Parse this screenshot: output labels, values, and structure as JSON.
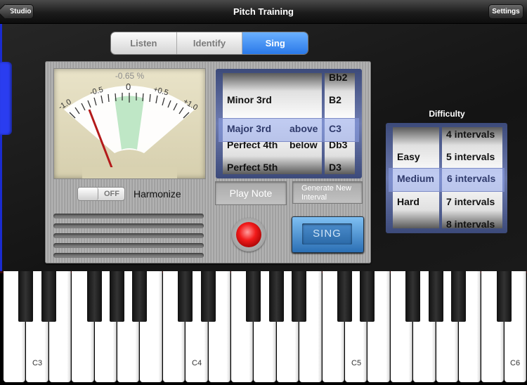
{
  "nav": {
    "title": "Pitch Training",
    "back_label": "Studio",
    "settings_label": "Settings"
  },
  "tabs": [
    {
      "label": "Listen"
    },
    {
      "label": "Identify"
    },
    {
      "label": "Sing"
    }
  ],
  "selected_tab": "Sing",
  "meter": {
    "readout": "-0.65 %",
    "scale_labels": [
      "-1.0",
      "-0.5",
      "0",
      "+0.5",
      "+1.0"
    ]
  },
  "interval_picker": {
    "intervals": [
      "Minor 3rd",
      "Major 3rd",
      "Perfect 4th",
      "Perfect 5th"
    ],
    "selected_interval": "Major 3rd",
    "directions": [
      "above",
      "below"
    ],
    "selected_direction": "above",
    "notes": [
      "Bb2",
      "B2",
      "C3",
      "Db3",
      "D3"
    ],
    "selected_note": "C3"
  },
  "harmonize": {
    "label": "Harmonize",
    "state": "OFF"
  },
  "buttons": {
    "play_note": "Play Note",
    "generate_line1": "Generate New",
    "generate_line2": "Interval",
    "sing": "SING"
  },
  "difficulty": {
    "title": "Difficulty",
    "levels": [
      "Easy",
      "Medium",
      "Hard"
    ],
    "selected_level": "Medium",
    "interval_counts": [
      "4 intervals",
      "5 intervals",
      "6 intervals",
      "7 intervals",
      "8 intervals"
    ],
    "selected_count": "6 intervals"
  },
  "keyboard": {
    "labels": [
      "C3",
      "C4",
      "C5",
      "C6"
    ]
  },
  "colors": {
    "accent_blue": "#2a79e8",
    "record_red": "#f21a1a"
  }
}
